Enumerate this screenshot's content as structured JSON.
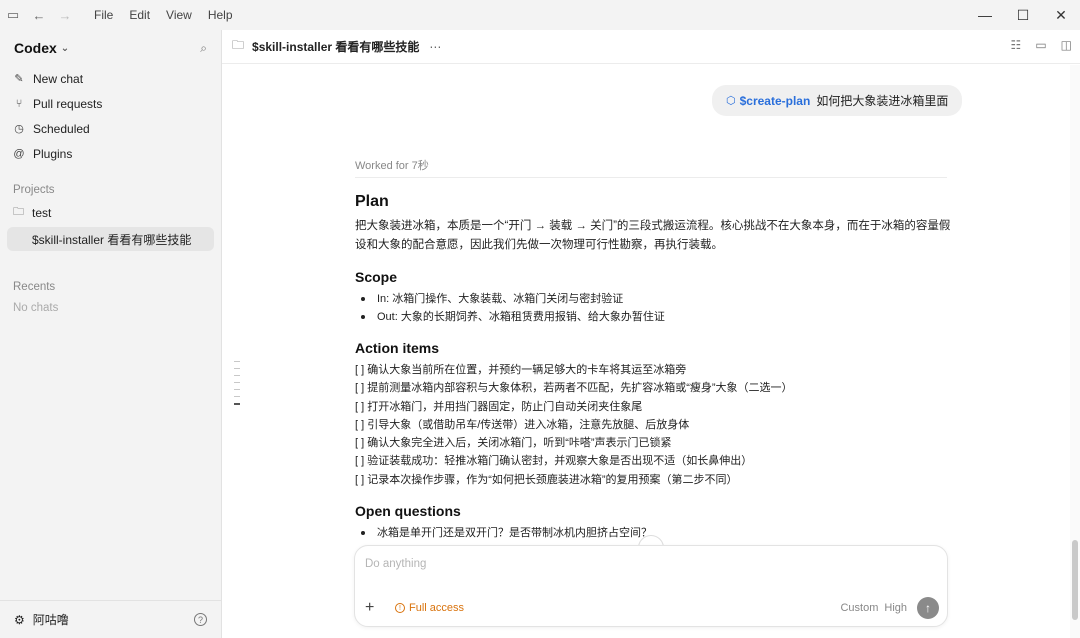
{
  "menu": {
    "file": "File",
    "edit": "Edit",
    "view": "View",
    "help": "Help"
  },
  "sidebar": {
    "brand": "Codex",
    "nav": [
      {
        "label": "New chat",
        "icon": "edit-icon"
      },
      {
        "label": "Pull requests",
        "icon": "pull-request-icon"
      },
      {
        "label": "Scheduled",
        "icon": "clock-icon"
      },
      {
        "label": "Plugins",
        "icon": "at-icon"
      }
    ],
    "projects_label": "Projects",
    "project": "test",
    "chat": "$skill-installer 看看有哪些技能",
    "recents_label": "Recents",
    "no_chats": "No chats",
    "user": "阿咕噜"
  },
  "main": {
    "title": "$skill-installer 看看有哪些技能",
    "user_message": {
      "skill": "$create-plan",
      "text": "如何把大象装进冰箱里面"
    },
    "worked": "Worked for 7秒",
    "plan": {
      "heading": "Plan",
      "intro": "把大象装进冰箱，本质是一个“开门 → 装载 → 关门”的三段式搬运流程。核心挑战不在大象本身，而在于冰箱的容量假设和大象的配合意愿，因此我们先做一次物理可行性勘察，再执行装载。",
      "scope_heading": "Scope",
      "scope": [
        "In: 冰箱门操作、大象装载、冰箱门关闭与密封验证",
        "Out: 大象的长期饲养、冰箱租赁费用报销、给大象办暂住证"
      ],
      "actions_heading": "Action items",
      "actions": [
        "[ ] 确认大象当前所在位置，并预约一辆足够大的卡车将其运至冰箱旁",
        "[ ] 提前测量冰箱内部容积与大象体积，若两者不匹配，先扩容冰箱或“瘦身”大象（二选一）",
        "[ ] 打开冰箱门，并用挡门器固定，防止门自动关闭夹住象尾",
        "[ ] 引导大象（或借助吊车/传送带）进入冰箱，注意先放腿、后放身体",
        "[ ] 确认大象完全进入后，关闭冰箱门，听到“咔嗒”声表示门已锁紧",
        "[ ] 验证装载成功：轻推冰箱门确认密封，并观察大象是否出现不适（如长鼻伸出）",
        "[ ] 记录本次操作步骤，作为“如何把长颈鹿装进冰箱”的复用预案（第二步不同）"
      ],
      "questions_heading": "Open questions",
      "questions": [
        "冰箱是单开门还是双开门？是否带制冰机内胆挤占空间？"
      ]
    },
    "composer": {
      "placeholder": "Do anything",
      "full_access": "Full access",
      "model": "Custom",
      "effort": "High"
    }
  }
}
